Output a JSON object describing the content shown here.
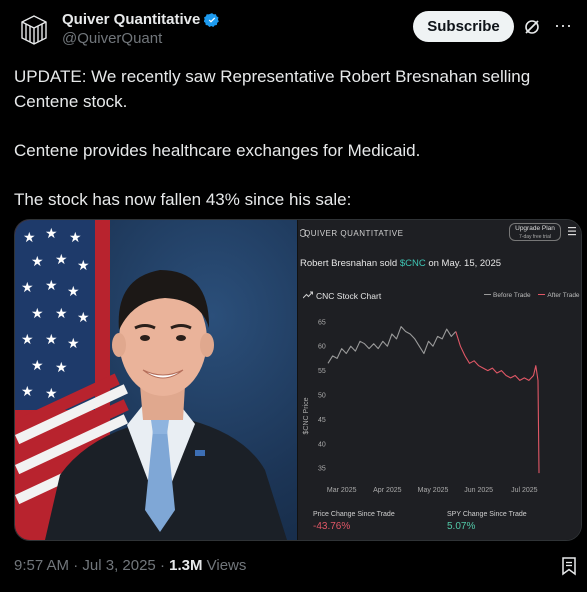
{
  "account": {
    "display_name": "Quiver Quantitative",
    "handle": "@QuiverQuant",
    "verified": true
  },
  "actions": {
    "subscribe_label": "Subscribe",
    "grok_icon": "grok-slash-icon",
    "more_icon": "more-horizontal-icon"
  },
  "tweet": {
    "paragraphs": [
      "UPDATE: We recently saw Representative Robert Bresnahan selling Centene stock.",
      "Centene provides healthcare exchanges for Medicaid.",
      "The stock has now fallen 43% since his sale:"
    ]
  },
  "chart_panel": {
    "brand": "QUIVER QUANTITATIVE",
    "upgrade_label": "Upgrade Plan",
    "upgrade_sub": "7-day free trial",
    "sold_prefix": "Robert Bresnahan sold ",
    "sold_ticker": "$CNC",
    "sold_suffix": " on May. 15, 2025",
    "chart_title": "CNC Stock Chart",
    "legend_before": "Before Trade",
    "legend_after": "After Trade",
    "price_change_label": "Price Change Since Trade",
    "price_change_value": "-43.76%",
    "spy_change_label": "SPY Change Since Trade",
    "spy_change_value": "5.07%"
  },
  "chart_data": {
    "type": "line",
    "title": "CNC Stock Chart",
    "xlabel": "",
    "ylabel": "$CNC Price",
    "ylim": [
      33,
      67
    ],
    "yticks": [
      35,
      40,
      45,
      50,
      55,
      60,
      65
    ],
    "xticks": [
      "Mar 2025",
      "Apr 2025",
      "May 2025",
      "Jun 2025",
      "Jul 2025"
    ],
    "x_range": [
      0,
      5.3
    ],
    "xtick_positions": [
      0.3,
      1.3,
      2.3,
      3.3,
      4.3
    ],
    "series": [
      {
        "name": "Before Trade",
        "color": "#9a9a9a",
        "x": [
          0,
          0.1,
          0.2,
          0.3,
          0.4,
          0.5,
          0.6,
          0.7,
          0.8,
          0.9,
          1.0,
          1.1,
          1.2,
          1.3,
          1.4,
          1.5,
          1.6,
          1.7,
          1.8,
          1.9,
          2.0,
          2.1,
          2.2,
          2.3,
          2.4,
          2.5,
          2.6,
          2.7,
          2.8
        ],
        "y": [
          56.5,
          58,
          57.5,
          59.5,
          58.5,
          60,
          59,
          61,
          60.5,
          59.5,
          60.5,
          59.5,
          61,
          60,
          62.5,
          61.5,
          64,
          63,
          62.5,
          61.5,
          60,
          58.5,
          61,
          60,
          62,
          61.5,
          63.5,
          62,
          63
        ]
      },
      {
        "name": "After Trade",
        "color": "#e05766",
        "x": [
          2.8,
          2.9,
          3.0,
          3.1,
          3.2,
          3.3,
          3.4,
          3.5,
          3.6,
          3.7,
          3.8,
          3.9,
          4.0,
          4.1,
          4.2,
          4.3,
          4.4,
          4.5,
          4.55,
          4.6,
          4.62
        ],
        "y": [
          63,
          60,
          58,
          56.5,
          57,
          56,
          55.5,
          55,
          55.5,
          54.5,
          55,
          54,
          53.5,
          54,
          53,
          53.5,
          53,
          54,
          56,
          53,
          34
        ]
      }
    ],
    "legend": "top-right",
    "grid": false
  },
  "footer": {
    "time": "9:57 AM",
    "separator": " · ",
    "date": "Jul 3, 2025",
    "views_count": "1.3M",
    "views_label": " Views"
  }
}
